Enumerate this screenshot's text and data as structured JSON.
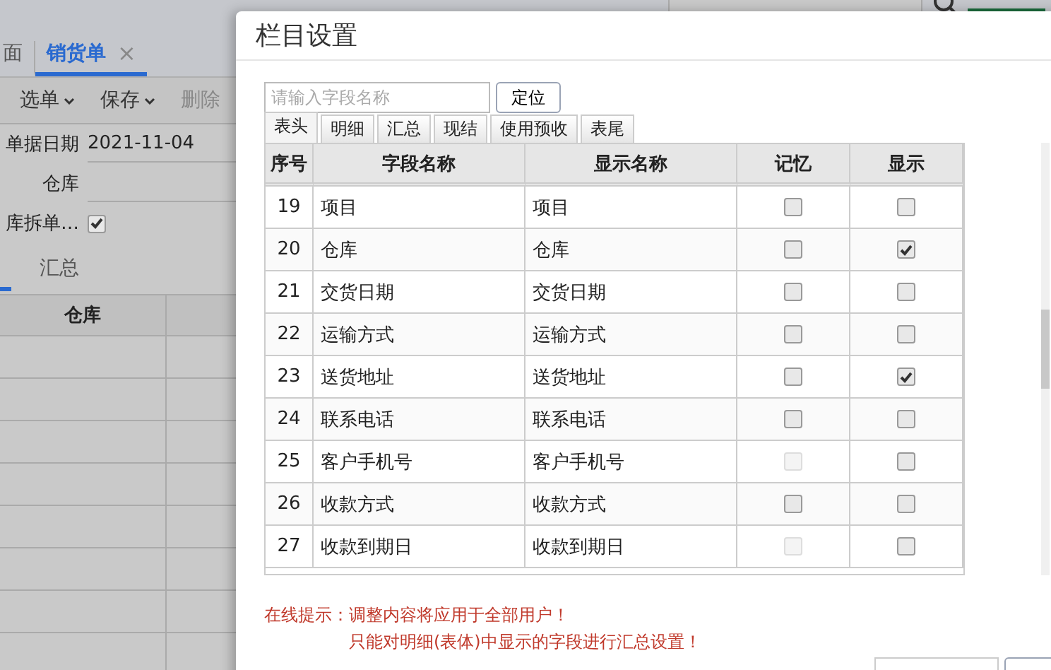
{
  "app_tabs": [
    {
      "label": "面",
      "selected": false
    },
    {
      "label": "销货单",
      "selected": true,
      "close": "×"
    }
  ],
  "toolbar": [
    {
      "label": "选单",
      "dropdown": true,
      "disabled": false
    },
    {
      "label": "保存",
      "dropdown": true,
      "disabled": false
    },
    {
      "label": "删除",
      "dropdown": false,
      "disabled": true
    }
  ],
  "form": {
    "date_label": "单据日期",
    "date_value": "2021-11-04",
    "warehouse_label": "仓库",
    "split_label": "库拆单…",
    "split_checked": true
  },
  "sub_tab": {
    "label": "汇总"
  },
  "bg_table": {
    "column": "仓库"
  },
  "dialog": {
    "title": "栏目设置",
    "search": {
      "placeholder": "请输入字段名称",
      "button": "定位"
    },
    "tabs": [
      {
        "label": "表头",
        "selected": true
      },
      {
        "label": "明细",
        "selected": false
      },
      {
        "label": "汇总",
        "selected": false
      },
      {
        "label": "现结",
        "selected": false
      },
      {
        "label": "使用预收",
        "selected": false
      },
      {
        "label": "表尾",
        "selected": false
      }
    ],
    "columns": [
      "序号",
      "字段名称",
      "显示名称",
      "记忆",
      "显示"
    ],
    "rows": [
      {
        "no": "19",
        "field": "项目",
        "display": "项目",
        "memory": false,
        "memory_disabled": false,
        "show": false
      },
      {
        "no": "20",
        "field": "仓库",
        "display": "仓库",
        "memory": false,
        "memory_disabled": false,
        "show": true
      },
      {
        "no": "21",
        "field": "交货日期",
        "display": "交货日期",
        "memory": false,
        "memory_disabled": false,
        "show": false
      },
      {
        "no": "22",
        "field": "运输方式",
        "display": "运输方式",
        "memory": false,
        "memory_disabled": false,
        "show": false
      },
      {
        "no": "23",
        "field": "送货地址",
        "display": "送货地址",
        "memory": false,
        "memory_disabled": false,
        "show": true
      },
      {
        "no": "24",
        "field": "联系电话",
        "display": "联系电话",
        "memory": false,
        "memory_disabled": false,
        "show": false
      },
      {
        "no": "25",
        "field": "客户手机号",
        "display": "客户手机号",
        "memory": false,
        "memory_disabled": true,
        "show": false
      },
      {
        "no": "26",
        "field": "收款方式",
        "display": "收款方式",
        "memory": false,
        "memory_disabled": false,
        "show": false
      },
      {
        "no": "27",
        "field": "收款到期日",
        "display": "收款到期日",
        "memory": false,
        "memory_disabled": true,
        "show": false
      }
    ],
    "notice_label": "在线提示：",
    "notice_lines": [
      "调整内容将应用于全部用户！",
      "只能对明细(表体)中显示的字段进行汇总设置！"
    ],
    "footer": true
  }
}
